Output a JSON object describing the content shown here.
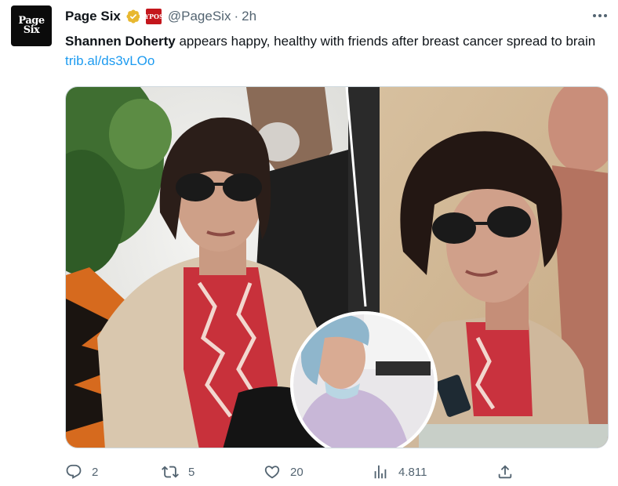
{
  "author": {
    "avatar_line1": "Page",
    "avatar_line2": "Six",
    "name": "Page Six",
    "affiliate_line1": "NY",
    "affiliate_line2": "POST",
    "handle": "@PageSix",
    "separator": "·",
    "time": "2h"
  },
  "tweet": {
    "bold_name": "Shannen Doherty",
    "text": " appears happy, healthy with friends after breast cancer spread to brain ",
    "link": "trib.al/ds3vLOo"
  },
  "actions": {
    "replies": "2",
    "retweets": "5",
    "likes": "20",
    "views": "4.811"
  },
  "icons": {
    "more": "more-dots-icon",
    "verified": "verified-gold-check-icon",
    "reply": "reply-icon",
    "retweet": "retweet-icon",
    "like": "heart-icon",
    "views": "views-bar-chart-icon",
    "share": "share-icon"
  },
  "colors": {
    "text": "#0f1419",
    "secondary": "#536471",
    "link": "#1d9bf0",
    "verified_gold": "#e8b830"
  }
}
